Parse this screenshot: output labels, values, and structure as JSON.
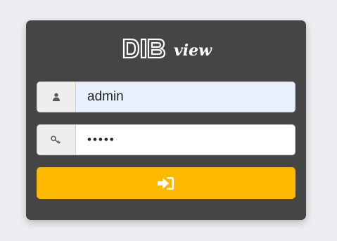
{
  "brand": {
    "logo_mark": "DIB",
    "logo_word": "view"
  },
  "login": {
    "username": {
      "value": "admin",
      "icon": "user-icon"
    },
    "password": {
      "value": "•••••",
      "icon": "key-icon"
    },
    "submit": {
      "icon": "sign-in-icon"
    }
  },
  "colors": {
    "background": "#ecedf1",
    "card": "#454545",
    "accent": "#fdb800",
    "autofill": "#e8f0fd"
  }
}
